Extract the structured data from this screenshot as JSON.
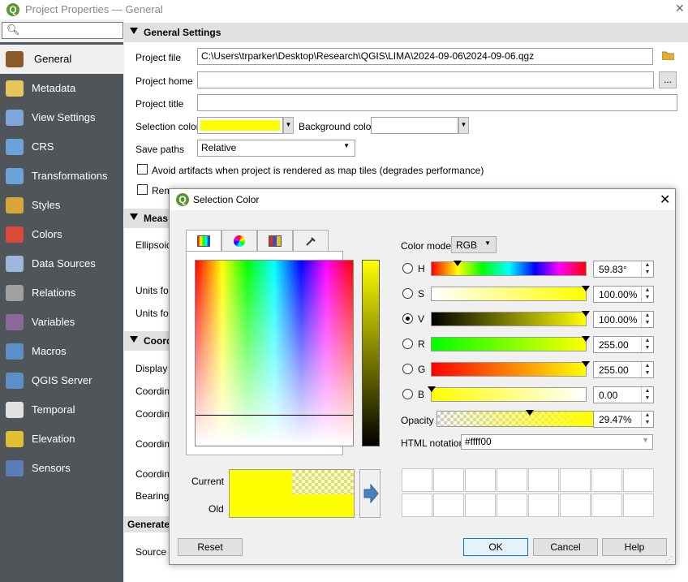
{
  "window": {
    "title": "Project Properties — General",
    "close_glyph": "✕"
  },
  "search": {
    "placeholder": "",
    "icon": "search-icon"
  },
  "sidebar": {
    "items": [
      {
        "label": "General",
        "icon": "hammer-icon",
        "active": true,
        "color": "#8a5a2b"
      },
      {
        "label": "Metadata",
        "icon": "metadata-icon",
        "color": "#e6c55a"
      },
      {
        "label": "View Settings",
        "icon": "view-settings-icon",
        "color": "#7ea6d8"
      },
      {
        "label": "CRS",
        "icon": "globe-icon",
        "color": "#6aa3d9"
      },
      {
        "label": "Transformations",
        "icon": "transform-globe-icon",
        "color": "#6aa3d9"
      },
      {
        "label": "Styles",
        "icon": "paintbrush-icon",
        "color": "#d9a63a"
      },
      {
        "label": "Colors",
        "icon": "palette-icon",
        "color": "#d94a3a"
      },
      {
        "label": "Data Sources",
        "icon": "table-icon",
        "color": "#9cb7d9"
      },
      {
        "label": "Relations",
        "icon": "relations-icon",
        "color": "#a0a0a0"
      },
      {
        "label": "Variables",
        "icon": "epsilon-icon",
        "color": "#8a6a9a"
      },
      {
        "label": "Macros",
        "icon": "macro-icon",
        "color": "#5a8fc8"
      },
      {
        "label": "QGIS Server",
        "icon": "server-icon",
        "color": "#5a8fc8"
      },
      {
        "label": "Temporal",
        "icon": "clock-icon",
        "color": "#e0e0e0"
      },
      {
        "label": "Elevation",
        "icon": "elevation-icon",
        "color": "#e0c030"
      },
      {
        "label": "Sensors",
        "icon": "sensor-icon",
        "color": "#5a7fb8"
      }
    ]
  },
  "general": {
    "group_title": "General Settings",
    "project_file_label": "Project file",
    "project_file_value": "C:\\Users\\trparker\\Desktop\\Research\\QGIS\\LIMA\\2024-09-06\\2024-09-06.qgz",
    "project_home_label": "Project home",
    "project_home_value": "",
    "browse_label": "...",
    "project_title_label": "Project title",
    "project_title_value": "",
    "selection_color_label": "Selection color",
    "selection_color": "#ffff00",
    "background_color_label": "Background color",
    "background_color": "#ffffff",
    "save_paths_label": "Save paths",
    "save_paths_value": "Relative",
    "avoid_artifacts_label": "Avoid artifacts when project is rendered as map tiles (degrades performance)",
    "remember_label": "Rem"
  },
  "partial_groups": {
    "measurements_title": "Meas",
    "ellipsoid_label": "Ellipsoid",
    "units_for_1": "Units for",
    "units_for_2": "Units for",
    "coord_title": "Coord",
    "display_label": "Display c",
    "coordina_1": "Coordina",
    "coordina_2": "Coordina",
    "coordina_3": "Coordina",
    "coordina_4": "Coordina",
    "bearing_label": "Bearing",
    "generate_title": "Generate",
    "source_label": "Source la"
  },
  "color_dialog": {
    "title": "Selection Color",
    "tabs": [
      "color-ramp-tab",
      "color-wheel-tab",
      "swatch-grid-tab",
      "color-picker-tab"
    ],
    "color_model_label": "Color model",
    "color_model_value": "RGB",
    "channels": [
      {
        "key": "H",
        "value": "59.83°",
        "fraction": 0.166,
        "checked": false
      },
      {
        "key": "S",
        "value": "100.00%",
        "fraction": 1.0,
        "checked": false
      },
      {
        "key": "V",
        "value": "100.00%",
        "fraction": 1.0,
        "checked": true
      },
      {
        "key": "R",
        "value": "255.00",
        "fraction": 1.0,
        "checked": false
      },
      {
        "key": "G",
        "value": "255.00",
        "fraction": 1.0,
        "checked": false
      },
      {
        "key": "B",
        "value": "0.00",
        "fraction": 0.0,
        "checked": false
      }
    ],
    "opacity_label": "Opacity",
    "opacity_value": "29.47%",
    "opacity_fraction": 0.2947,
    "html_notation_label": "HTML notation",
    "html_notation_value": "#ffff00",
    "current_label": "Current",
    "old_label": "Old",
    "current_color": "#ffff00",
    "old_color": "#ffff00",
    "reset_label": "Reset",
    "ok_label": "OK",
    "cancel_label": "Cancel",
    "help_label": "Help"
  }
}
